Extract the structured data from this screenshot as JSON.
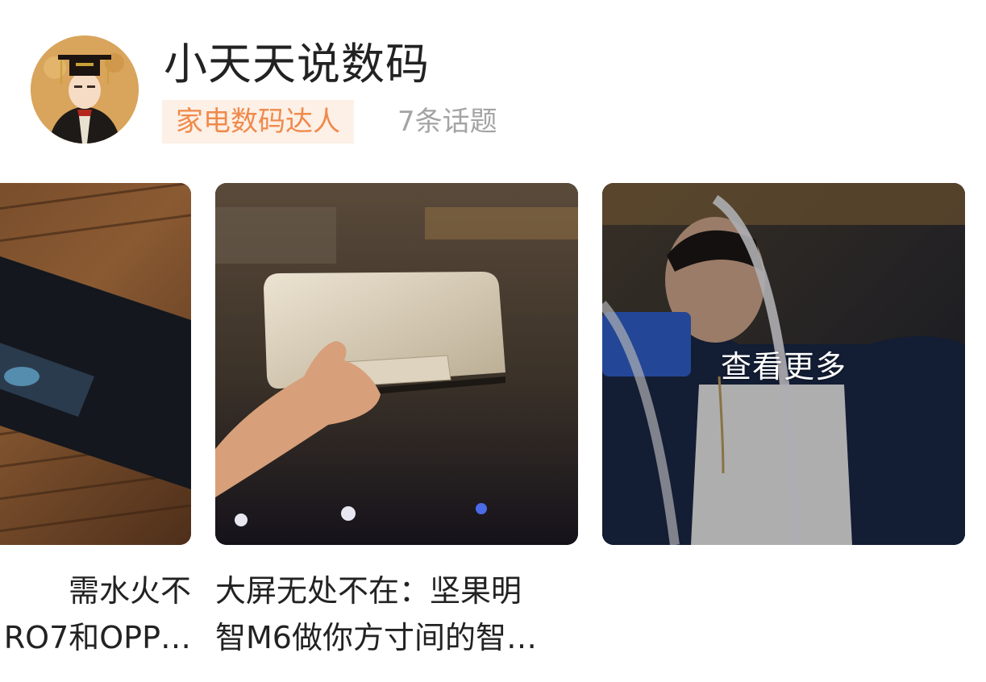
{
  "author": {
    "name": "小天天说数码",
    "badge": "家电数码达人",
    "topic_count": "7条话题"
  },
  "cards": [
    {
      "title_line1": "需水火不",
      "title_line2": "RO7和OPP…"
    },
    {
      "title_line1": "大屏无处不在：坚果明",
      "title_line2": "智M6做你方寸间的智…"
    },
    {
      "overlay": "查看更多"
    }
  ],
  "colors": {
    "badge_bg": "#fdf0e6",
    "badge_text": "#f08a4b",
    "muted_text": "#a4a4a4",
    "primary_text": "#222222"
  }
}
